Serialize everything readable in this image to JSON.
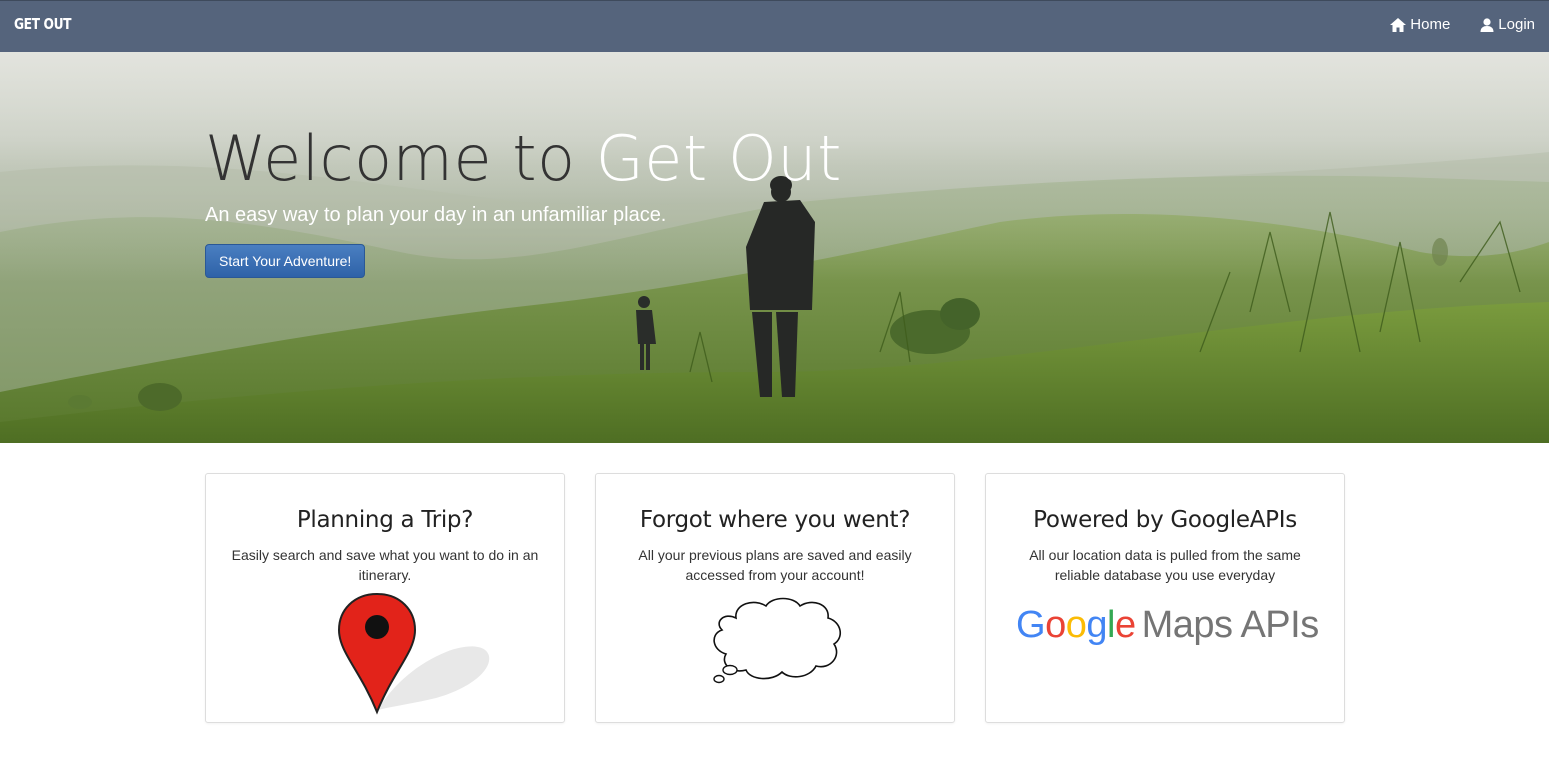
{
  "navbar": {
    "brand": "GET OUT",
    "links": [
      {
        "label": "Home",
        "icon": "home-icon"
      },
      {
        "label": "Login",
        "icon": "user-icon"
      }
    ]
  },
  "hero": {
    "title_lead": "Welcome to ",
    "title_accent": "Get Out",
    "subtitle": "An easy way to plan your day in an unfamiliar place.",
    "cta_label": "Start Your Adventure!"
  },
  "cards": [
    {
      "title": "Planning a Trip?",
      "text": "Easily search and save what you want to do in an itinerary.",
      "icon": "map-pin-icon"
    },
    {
      "title": "Forgot where you went?",
      "text": "All your previous plans are saved and easily accessed from your account!",
      "icon": "thought-bubble-icon"
    },
    {
      "title": "Powered by GoogleAPIs",
      "text": "All our location data is pulled from the same reliable database you use everyday",
      "icon": "google-maps-apis-logo"
    }
  ],
  "google_logo": {
    "letters": [
      "G",
      "o",
      "o",
      "g",
      "l",
      "e"
    ],
    "colors": [
      "#4285F4",
      "#EA4335",
      "#FBBC05",
      "#4285F4",
      "#34A853",
      "#EA4335"
    ],
    "suffix": "Maps APIs"
  },
  "colors": {
    "navbar": "#55647c",
    "button": "#3571b8",
    "pin": "#e2231a"
  }
}
